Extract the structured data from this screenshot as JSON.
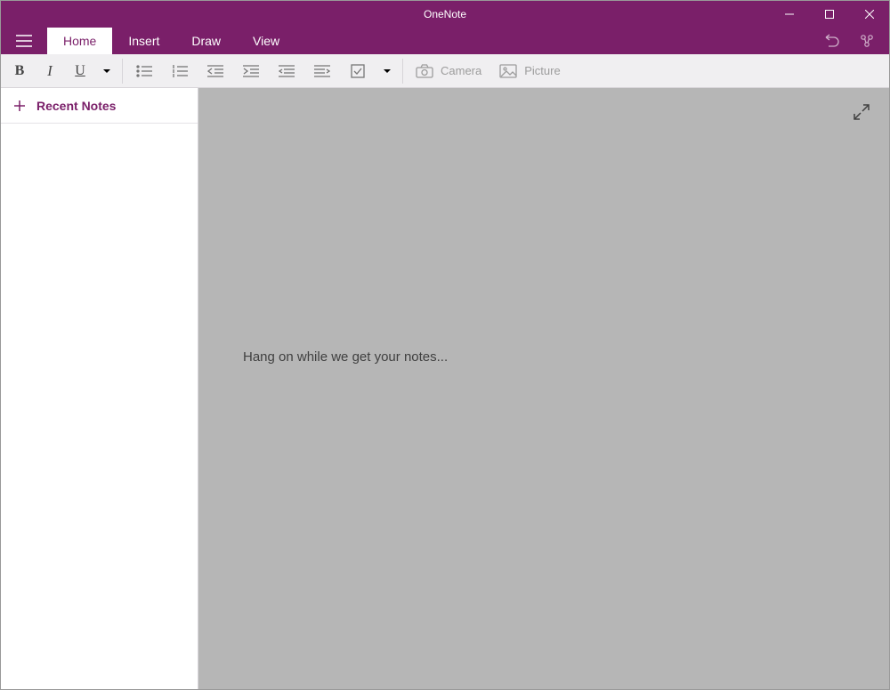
{
  "app": {
    "title": "OneNote"
  },
  "tabs": {
    "items": [
      {
        "label": "Home",
        "active": true
      },
      {
        "label": "Insert",
        "active": false
      },
      {
        "label": "Draw",
        "active": false
      },
      {
        "label": "View",
        "active": false
      }
    ]
  },
  "ribbon": {
    "bold": "B",
    "italic": "I",
    "underline": "U",
    "camera_label": "Camera",
    "picture_label": "Picture"
  },
  "sidebar": {
    "header": "Recent Notes"
  },
  "canvas": {
    "loading_message": "Hang on while we get your notes..."
  }
}
